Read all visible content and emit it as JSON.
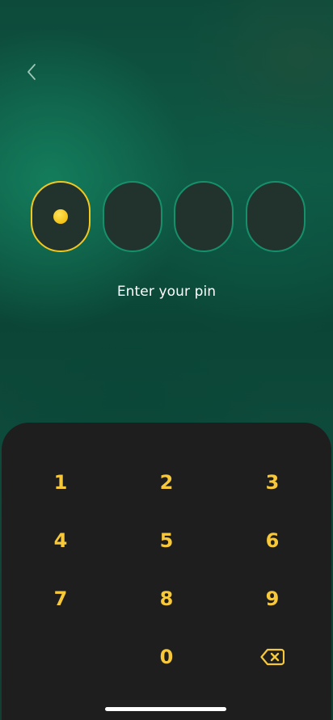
{
  "header": {
    "back_icon": "chevron-left-icon"
  },
  "pin": {
    "length": 4,
    "filled": 1,
    "prompt": "Enter your pin",
    "colors": {
      "active_border": "#f3c81e",
      "inactive_border": "#16906a",
      "cell_fill": "#22332d",
      "dot": "#f2c314"
    }
  },
  "keypad": {
    "keys": {
      "k1": "1",
      "k2": "2",
      "k3": "3",
      "k4": "4",
      "k5": "5",
      "k6": "6",
      "k7": "7",
      "k8": "8",
      "k9": "9",
      "k0": "0"
    },
    "backspace_icon": "backspace-icon",
    "key_color": "#f6c83a",
    "background": "#1e1e1e"
  }
}
